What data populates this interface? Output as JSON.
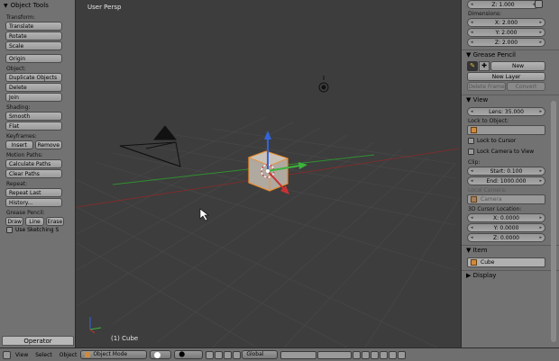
{
  "left": {
    "title": "Object Tools",
    "transform": {
      "label": "Transform:",
      "translate": "Translate",
      "rotate": "Rotate",
      "scale": "Scale",
      "origin": "Origin"
    },
    "object": {
      "label": "Object:",
      "duplicate": "Duplicate Objects",
      "delete": "Delete",
      "join": "Join"
    },
    "shading": {
      "label": "Shading:",
      "smooth": "Smooth",
      "flat": "Flat"
    },
    "keyframes": {
      "label": "Keyframes:",
      "insert": "Insert",
      "remove": "Remove"
    },
    "motion": {
      "label": "Motion Paths:",
      "calc": "Calculate Paths",
      "clear": "Clear Paths"
    },
    "repeat": {
      "label": "Repeat:",
      "last": "Repeat Last",
      "history": "History..."
    },
    "grease": {
      "label": "Grease Pencil:",
      "draw": "Draw",
      "line": "Line",
      "erase": "Erase",
      "sketch": "Use Sketching S"
    },
    "operator": "Operator"
  },
  "viewport": {
    "title": "User Persp",
    "object": "(1) Cube"
  },
  "right": {
    "scale_z": "Z: 1.000",
    "dimensions": {
      "label": "Dimensions:",
      "x": "X: 2.000",
      "y": "Y: 2.000",
      "z": "Z: 2.000"
    },
    "grease": {
      "title": "Grease Pencil",
      "new": "New",
      "new_layer": "New Layer",
      "delete_frame": "Delete Frame",
      "convert": "Convert"
    },
    "view": {
      "title": "View",
      "lens": "Lens: 35.000",
      "lock_obj": "Lock to Object:",
      "lock_cursor": "Lock to Cursor",
      "lock_camera": "Lock Camera to View",
      "clip": "Clip:",
      "start": "Start: 0.100",
      "end": "End: 1000.000",
      "local_camera": "Local Camera:",
      "camera": "Camera",
      "cursor_label": "3D Cursor Location:",
      "cx": "X: 0.0000",
      "cy": "Y: 0.0000",
      "cz": "Z: 0.0000"
    },
    "item": {
      "title": "Item",
      "name": "Cube"
    },
    "display": {
      "title": "Display"
    }
  },
  "bottom": {
    "view": "View",
    "select": "Select",
    "object": "Object",
    "mode": "Object Mode",
    "orientation": "Global"
  },
  "colors": {
    "x_axis": "#c83232",
    "y_axis": "#3cb43c",
    "z_axis": "#3264dc",
    "selection": "#f08c28"
  }
}
